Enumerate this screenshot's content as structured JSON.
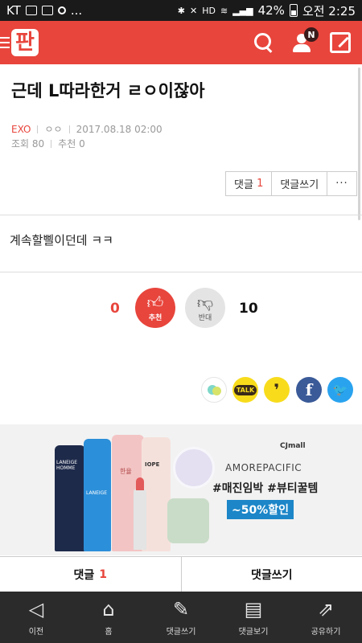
{
  "status_bar": {
    "carrier": "KT",
    "extra_dots": "...",
    "battery": "42%",
    "time": "오전 2:25",
    "hd_label": "HD"
  },
  "app": {
    "logo": "판",
    "notification_badge": "N"
  },
  "post": {
    "title": "근데 L따라한거 ㄹㅇ이잖아",
    "author": "EXO",
    "author_extra": "ㅇㅇ",
    "date": "2017.08.18 02:00",
    "views": "조회 80",
    "recommends": "추천 0",
    "body": "계속할삘이던데 ㅋㅋ"
  },
  "actions": {
    "comment_label": "댓글",
    "comment_count": "1",
    "write_comment": "댓글쓰기",
    "more": "···"
  },
  "vote": {
    "up_count": "0",
    "up_label": "추천",
    "down_label": "반대",
    "down_count": "10"
  },
  "share": {
    "kakao_label": "TALK",
    "story_glyph": "❜",
    "facebook_glyph": "f",
    "twitter_glyph": "🐦"
  },
  "ad": {
    "shop": "CJmall",
    "brand": "AMOREPACIFIC",
    "line2": "#매진임박 #뷰티꿀템",
    "line3": "~50%할인",
    "p1_text": "LANEIGE HOMME",
    "p2_text": "LANEIGE",
    "p3_text": "한율",
    "p5_text": "IOPE"
  },
  "comment_bar": {
    "left_label": "댓글",
    "left_count": "1",
    "right_label": "댓글쓰기"
  },
  "nav": [
    {
      "label": "이전",
      "icon": "back-icon",
      "glyph": "◁"
    },
    {
      "label": "홈",
      "icon": "home-icon",
      "glyph": "⌂"
    },
    {
      "label": "댓글쓰기",
      "icon": "write-comment-icon",
      "glyph": "✎"
    },
    {
      "label": "댓글보기",
      "icon": "view-comments-icon",
      "glyph": "▤"
    },
    {
      "label": "공유하기",
      "icon": "share-icon",
      "glyph": "⇗"
    }
  ],
  "colors": {
    "brand_red": "#e8453c",
    "nav_bg": "#2b2b2b",
    "status_bg": "#1a1a1a"
  }
}
